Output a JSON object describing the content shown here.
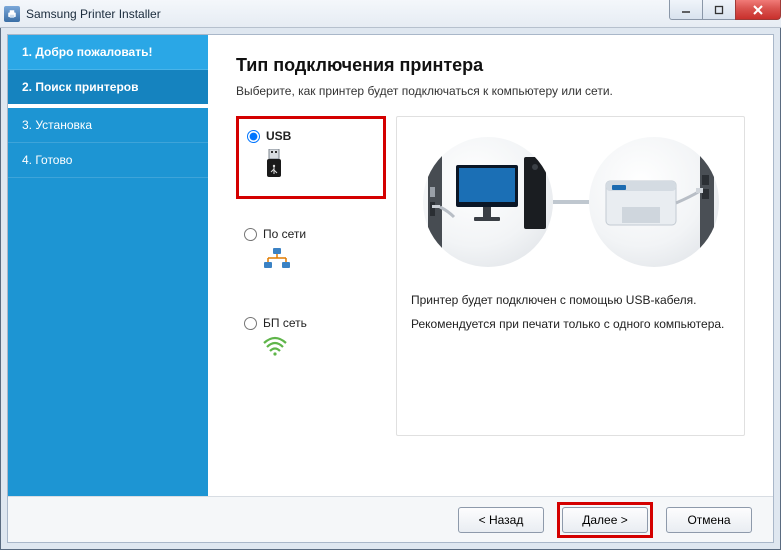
{
  "window": {
    "title": "Samsung Printer Installer"
  },
  "sidebar": {
    "steps": [
      {
        "label": "1. Добро пожаловать!"
      },
      {
        "label": "2. Поиск принтеров"
      },
      {
        "label": "3. Установка"
      },
      {
        "label": "4. Готово"
      }
    ]
  },
  "page": {
    "title": "Тип подключения принтера",
    "subtitle": "Выберите, как принтер будет подключаться к компьютеру или сети."
  },
  "options": {
    "usb": "USB",
    "network": "По сети",
    "wireless": "БП сеть"
  },
  "info": {
    "line1": "Принтер будет подключен с помощью USB-кабеля.",
    "line2": "Рекомендуется при печати только с одного компьютера."
  },
  "buttons": {
    "back": "< Назад",
    "next": "Далее >",
    "cancel": "Отмена"
  }
}
